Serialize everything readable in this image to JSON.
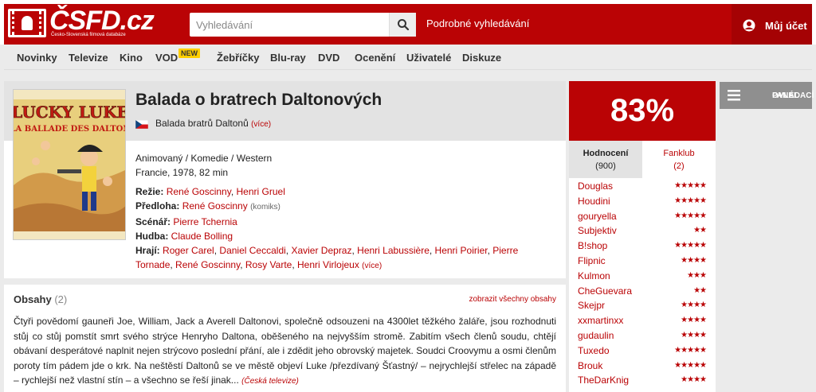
{
  "header": {
    "logo_text": "ČSFD.cz",
    "logo_subtitle": "Česko-Slovenská filmová databáze",
    "search_placeholder": "Vyhledávání",
    "advanced_search": "Podrobné vyhledávání",
    "account_label": "Můj účet"
  },
  "nav": {
    "items": [
      "Novinky",
      "Televize",
      "Kino",
      "VOD",
      "Žebříčky",
      "Blu-ray",
      "DVD",
      "Ocenění",
      "Uživatelé",
      "Diskuze"
    ],
    "new_badge": "NEW"
  },
  "film": {
    "title": "Balada o bratrech Daltonových",
    "alt_title": "Balada bratrů Daltonů",
    "alt_more": "(více)",
    "genres": "Animovaný / Komedie / Western",
    "origin": "Francie, 1978, 82 min",
    "credits": {
      "director_label": "Režie:",
      "directors": [
        "René Goscinny",
        "Henri Gruel"
      ],
      "source_label": "Předloha:",
      "source": "René Goscinny",
      "source_note": "(komiks)",
      "screenplay_label": "Scénář:",
      "screenplay": "Pierre Tchernia",
      "music_label": "Hudba:",
      "music": "Claude Bolling",
      "cast_label": "Hrají:",
      "cast": [
        "Roger Carel",
        "Daniel Ceccaldi",
        "Xavier Depraz",
        "Henri Labussière",
        "Henri Poirier",
        "Pierre Tornade",
        "René Goscinny",
        "Rosy Varte",
        "Henri Virlojeux"
      ],
      "cast_more": "(více)"
    }
  },
  "plot": {
    "heading": "Obsahy",
    "count": "(2)",
    "show_all": "zobrazit všechny obsahy",
    "text": "Čtyři povědomí gauneři Joe, William, Jack a Averell Daltonovi, společně odsouzeni na 4300let těžkého žaláře, jsou rozhodnuti stůj co stůj pomstít smrt svého strýce Henryho Daltona, oběšeného na nejvyšším stromě. Zabitím všech členů soudu, chtějí obávaní desperátové naplnit nejen strýcovo poslední přání, ale i zdědit jeho obrovský majetek. Soudci Croovymu a osmi členům poroty tím pádem jde o krk. Na neštěstí Daltonů se ve městě objeví Luke /přezdívaný Šťastný/ – nejrychlejší střelec na západě – rychlejší než vlastní stín – a všechno se řeší jinak...",
    "source": "(Česká televize)"
  },
  "rating": {
    "percent": "83%",
    "tab_ratings": "Hodnocení",
    "tab_ratings_count": "(900)",
    "tab_fanclub": "Fanklub",
    "tab_fanclub_count": "(2)",
    "users": [
      {
        "name": "Douglas",
        "stars": 5
      },
      {
        "name": "Houdini",
        "stars": 5
      },
      {
        "name": "gouryella",
        "stars": 5
      },
      {
        "name": "Subjektiv",
        "stars": 2
      },
      {
        "name": "B!shop",
        "stars": 5
      },
      {
        "name": "Flipnic",
        "stars": 4
      },
      {
        "name": "Kulmon",
        "stars": 3
      },
      {
        "name": "CheGuevara",
        "stars": 2
      },
      {
        "name": "Skejpr",
        "stars": 4
      },
      {
        "name": "xxmartinxx",
        "stars": 4
      },
      {
        "name": "gudaulin",
        "stars": 4
      },
      {
        "name": "Tuxedo",
        "stars": 5
      },
      {
        "name": "Brouk",
        "stars": 5
      },
      {
        "name": "TheDarKnig",
        "stars": 4
      }
    ]
  },
  "control_panel": {
    "label_line1": "OVLÁDACÍ",
    "label_line2": "PANEL"
  },
  "colors": {
    "brand_red": "#ba0305",
    "badge_yellow": "#ffcf00"
  }
}
